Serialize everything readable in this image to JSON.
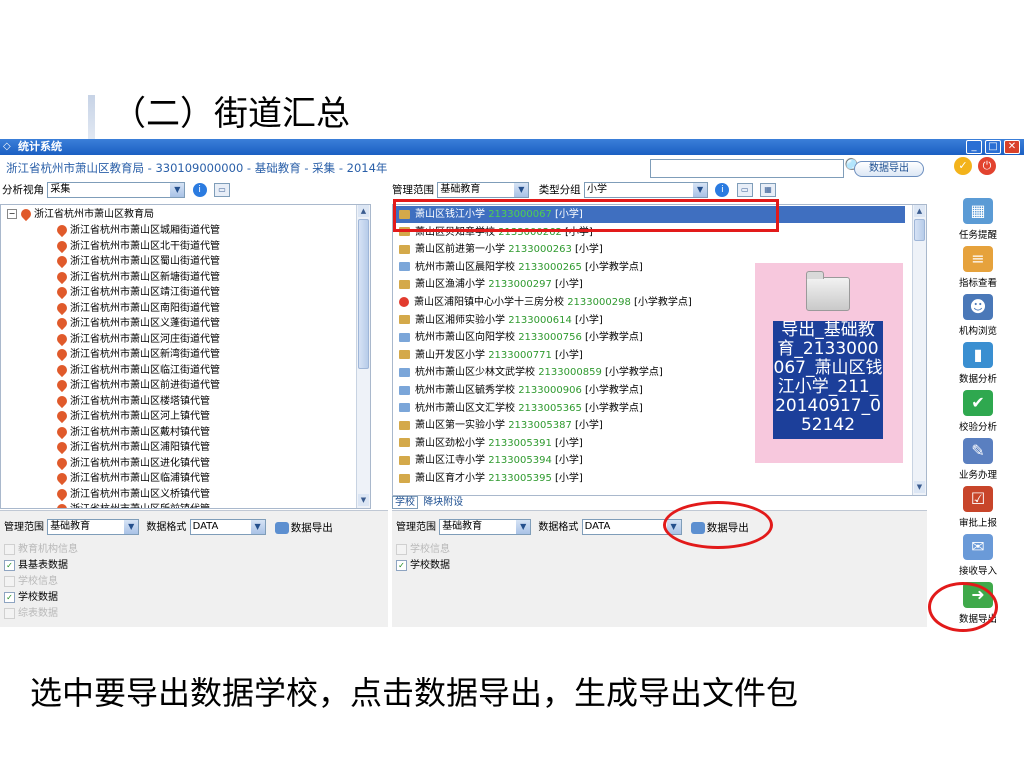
{
  "slide": {
    "title": "（二）街道汇总",
    "caption": "选中要导出数据学校，点击数据导出，生成导出文件包"
  },
  "window": {
    "title": "统计系统",
    "breadcrumb": "浙江省杭州市萧山区教育局 - 330109000000 - 基础教育 - 采集 - 2014年",
    "search_placeholder": "",
    "export_top_label": "数据导出"
  },
  "left_toolbar": {
    "label": "分析视角",
    "value": "采集"
  },
  "tree": {
    "root": "浙江省杭州市萧山区教育局",
    "items": [
      "浙江省杭州市萧山区城厢街道代管",
      "浙江省杭州市萧山区北干街道代管",
      "浙江省杭州市萧山区蜀山街道代管",
      "浙江省杭州市萧山区新塘街道代管",
      "浙江省杭州市萧山区靖江街道代管",
      "浙江省杭州市萧山区南阳街道代管",
      "浙江省杭州市萧山区义蓬街道代管",
      "浙江省杭州市萧山区河庄街道代管",
      "浙江省杭州市萧山区新湾街道代管",
      "浙江省杭州市萧山区临江街道代管",
      "浙江省杭州市萧山区前进街道代管",
      "浙江省杭州市萧山区楼塔镇代管",
      "浙江省杭州市萧山区河上镇代管",
      "浙江省杭州市萧山区戴村镇代管",
      "浙江省杭州市萧山区浦阳镇代管",
      "浙江省杭州市萧山区进化镇代管",
      "浙江省杭州市萧山区临浦镇代管",
      "浙江省杭州市萧山区义桥镇代管",
      "浙江省杭州市萧山区所前镇代管"
    ]
  },
  "right_toolbar": {
    "scope_label": "管理范围",
    "scope_value": "基础教育",
    "group_label": "类型分组",
    "group_value": "小学"
  },
  "schools": [
    {
      "name": "萧山区钱江小学",
      "code": "2133000067",
      "type": "[小学]",
      "icon": "house-icon",
      "selected": true
    },
    {
      "name": "萧山区贝知章学校",
      "code": "2133000262",
      "type": "[小学]",
      "icon": "house-icon"
    },
    {
      "name": "萧山区前进第一小学",
      "code": "2133000263",
      "type": "[小学]",
      "icon": "house-icon"
    },
    {
      "name": "杭州市萧山区晨阳学校",
      "code": "2133000265",
      "type": "[小学教学点]",
      "icon": "multi-house-icon"
    },
    {
      "name": "萧山区渔浦小学",
      "code": "2133000297",
      "type": "[小学]",
      "icon": "house-icon"
    },
    {
      "name": "萧山区浦阳镇中心小学十三房分校",
      "code": "2133000298",
      "type": "[小学教学点]",
      "icon": "stop-icon"
    },
    {
      "name": "萧山区湘师实验小学",
      "code": "2133000614",
      "type": "[小学]",
      "icon": "house-icon"
    },
    {
      "name": "杭州市萧山区向阳学校",
      "code": "2133000756",
      "type": "[小学教学点]",
      "icon": "multi-house-icon"
    },
    {
      "name": "萧山开发区小学",
      "code": "2133000771",
      "type": "[小学]",
      "icon": "house-icon"
    },
    {
      "name": "杭州市萧山区少林文武学校",
      "code": "2133000859",
      "type": "[小学教学点]",
      "icon": "multi-house-icon"
    },
    {
      "name": "杭州市萧山区毓秀学校",
      "code": "2133000906",
      "type": "[小学教学点]",
      "icon": "multi-house-icon"
    },
    {
      "name": "杭州市萧山区文汇学校",
      "code": "2133005365",
      "type": "[小学教学点]",
      "icon": "multi-house-icon"
    },
    {
      "name": "萧山区第一实验小学",
      "code": "2133005387",
      "type": "[小学]",
      "icon": "house-icon"
    },
    {
      "name": "萧山区劲松小学",
      "code": "2133005391",
      "type": "[小学]",
      "icon": "house-icon"
    },
    {
      "name": "萧山区江寺小学",
      "code": "2133005394",
      "type": "[小学]",
      "icon": "house-icon"
    },
    {
      "name": "萧山区育才小学",
      "code": "2133005395",
      "type": "[小学]",
      "icon": "house-icon"
    }
  ],
  "tabs": [
    "学校",
    "降块附设"
  ],
  "preview": {
    "label": "导出_基础教育_2133000067_萧山区钱江小学_211_20140917_052142"
  },
  "bottom_left": {
    "scope_label": "管理范围",
    "scope_value": "基础教育",
    "format_label": "数据格式",
    "format_value": "DATA",
    "export_label": "数据导出",
    "checks": [
      {
        "label": "教育机构信息",
        "checked": false,
        "enabled": false
      },
      {
        "label": "县基表数据",
        "checked": true,
        "enabled": true
      },
      {
        "label": "学校信息",
        "checked": false,
        "enabled": false
      },
      {
        "label": "学校数据",
        "checked": true,
        "enabled": true
      },
      {
        "label": "综表数据",
        "checked": false,
        "enabled": false
      }
    ]
  },
  "bottom_right": {
    "scope_label": "管理范围",
    "scope_value": "基础教育",
    "format_label": "数据格式",
    "format_value": "DATA",
    "export_label": "数据导出",
    "checks": [
      {
        "label": "学校信息",
        "checked": false,
        "enabled": false
      },
      {
        "label": "学校数据",
        "checked": true,
        "enabled": true
      }
    ]
  },
  "sidebar": {
    "items": [
      {
        "label": "任务提醒",
        "icon": "calendar-icon",
        "color": "#5b9bd5"
      },
      {
        "label": "指标查看",
        "icon": "books-icon",
        "color": "#e6a23c"
      },
      {
        "label": "机构浏览",
        "icon": "user-icon",
        "color": "#4a78b8"
      },
      {
        "label": "数据分析",
        "icon": "bar-chart-icon",
        "color": "#3a8fd1"
      },
      {
        "label": "校验分析",
        "icon": "check-icon",
        "color": "#2fa84f"
      },
      {
        "label": "业务办理",
        "icon": "pen-icon",
        "color": "#5a7fc0"
      },
      {
        "label": "审批上报",
        "icon": "approve-icon",
        "color": "#c8452a"
      },
      {
        "label": "接收导入",
        "icon": "receive-icon",
        "color": "#6a9ad8"
      },
      {
        "label": "数据导出",
        "icon": "export-icon",
        "color": "#3fa94a"
      }
    ]
  }
}
